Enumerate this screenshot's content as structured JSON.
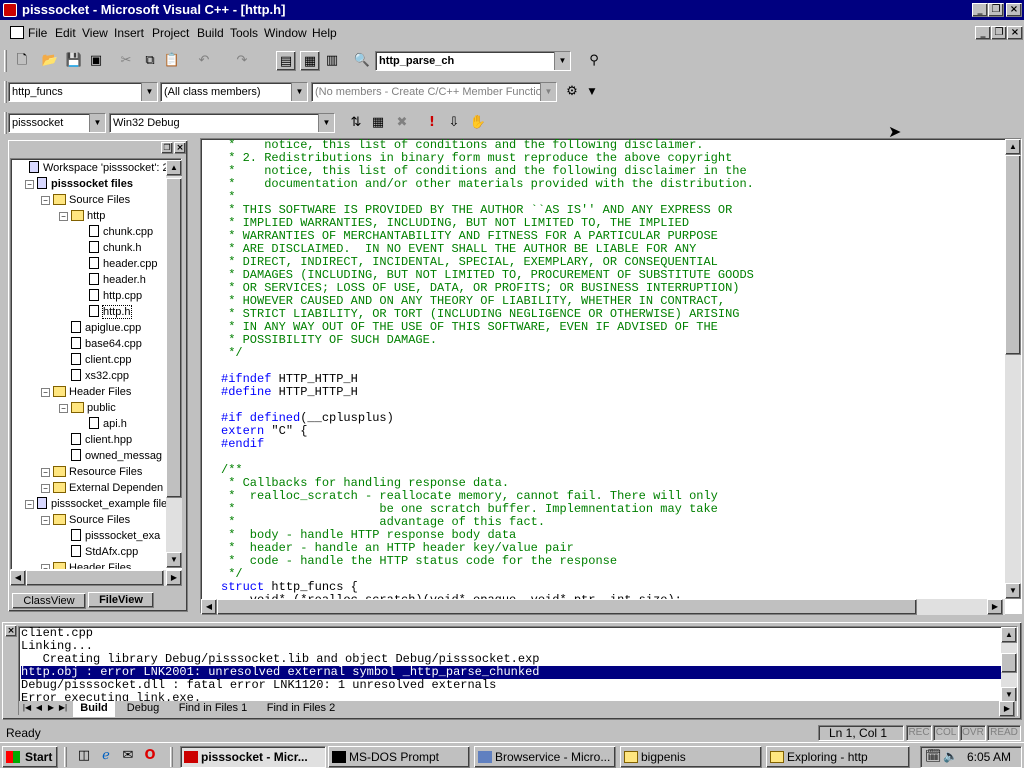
{
  "window": {
    "title": "pisssocket - Microsoft Visual C++ - [http.h]",
    "min": "_",
    "restore": "❐",
    "close": "×"
  },
  "menu": [
    "File",
    "Edit",
    "View",
    "Insert",
    "Project",
    "Build",
    "Tools",
    "Window",
    "Help"
  ],
  "toolbar": {
    "find_combo": "http_parse_ch",
    "class_combo": "http_funcs",
    "filter_combo": "(All class members)",
    "members_combo": "(No members - Create C/C++ Member Function...",
    "project_combo": "pisssocket",
    "config_combo": "Win32 Debug"
  },
  "workspace": {
    "items": [
      {
        "label": "Workspace 'pisssocket': 2 p",
        "type": "ws",
        "level": 0
      },
      {
        "label": "pisssocket files",
        "type": "proj",
        "level": 1,
        "bold": true
      },
      {
        "label": "Source Files",
        "type": "folder",
        "level": 2
      },
      {
        "label": "http",
        "type": "folder",
        "level": 3
      },
      {
        "label": "chunk.cpp",
        "type": "file",
        "level": 4
      },
      {
        "label": "chunk.h",
        "type": "file",
        "level": 4
      },
      {
        "label": "header.cpp",
        "type": "file",
        "level": 4
      },
      {
        "label": "header.h",
        "type": "file",
        "level": 4
      },
      {
        "label": "http.cpp",
        "type": "file",
        "level": 4
      },
      {
        "label": "http.h",
        "type": "file",
        "level": 4
      },
      {
        "label": "apiglue.cpp",
        "type": "file",
        "level": 3
      },
      {
        "label": "base64.cpp",
        "type": "file",
        "level": 3
      },
      {
        "label": "client.cpp",
        "type": "file",
        "level": 3
      },
      {
        "label": "xs32.cpp",
        "type": "file",
        "level": 3
      },
      {
        "label": "Header Files",
        "type": "folder",
        "level": 2
      },
      {
        "label": "public",
        "type": "folder",
        "level": 3
      },
      {
        "label": "api.h",
        "type": "file",
        "level": 4
      },
      {
        "label": "client.hpp",
        "type": "file",
        "level": 3
      },
      {
        "label": "owned_messag",
        "type": "file",
        "level": 3
      },
      {
        "label": "Resource Files",
        "type": "folder",
        "level": 2
      },
      {
        "label": "External Dependen",
        "type": "folder",
        "level": 2
      },
      {
        "label": "pisssocket_example file",
        "type": "proj",
        "level": 1
      },
      {
        "label": "Source Files",
        "type": "folder",
        "level": 2
      },
      {
        "label": "pisssocket_exa",
        "type": "file",
        "level": 3
      },
      {
        "label": "StdAfx.cpp",
        "type": "file",
        "level": 3
      },
      {
        "label": "Header Files",
        "type": "folder",
        "level": 2
      }
    ],
    "tabs": [
      "ClassView",
      "FileView"
    ]
  },
  "code": [
    {
      "t": " *    notice, this list of conditions and the following disclaimer.",
      "c": "cm"
    },
    {
      "t": " * 2. Redistributions in binary form must reproduce the above copyright",
      "c": "cm"
    },
    {
      "t": " *    notice, this list of conditions and the following disclaimer in the",
      "c": "cm"
    },
    {
      "t": " *    documentation and/or other materials provided with the distribution.",
      "c": "cm"
    },
    {
      "t": " *",
      "c": "cm"
    },
    {
      "t": " * THIS SOFTWARE IS PROVIDED BY THE AUTHOR ``AS IS'' AND ANY EXPRESS OR",
      "c": "cm"
    },
    {
      "t": " * IMPLIED WARRANTIES, INCLUDING, BUT NOT LIMITED TO, THE IMPLIED",
      "c": "cm"
    },
    {
      "t": " * WARRANTIES OF MERCHANTABILITY AND FITNESS FOR A PARTICULAR PURPOSE",
      "c": "cm"
    },
    {
      "t": " * ARE DISCLAIMED.  IN NO EVENT SHALL THE AUTHOR BE LIABLE FOR ANY",
      "c": "cm"
    },
    {
      "t": " * DIRECT, INDIRECT, INCIDENTAL, SPECIAL, EXEMPLARY, OR CONSEQUENTIAL",
      "c": "cm"
    },
    {
      "t": " * DAMAGES (INCLUDING, BUT NOT LIMITED TO, PROCUREMENT OF SUBSTITUTE GOODS",
      "c": "cm"
    },
    {
      "t": " * OR SERVICES; LOSS OF USE, DATA, OR PROFITS; OR BUSINESS INTERRUPTION)",
      "c": "cm"
    },
    {
      "t": " * HOWEVER CAUSED AND ON ANY THEORY OF LIABILITY, WHETHER IN CONTRACT,",
      "c": "cm"
    },
    {
      "t": " * STRICT LIABILITY, OR TORT (INCLUDING NEGLIGENCE OR OTHERWISE) ARISING",
      "c": "cm"
    },
    {
      "t": " * IN ANY WAY OUT OF THE USE OF THIS SOFTWARE, EVEN IF ADVISED OF THE",
      "c": "cm"
    },
    {
      "t": " * POSSIBILITY OF SUCH DAMAGE.",
      "c": "cm"
    },
    {
      "t": " */",
      "c": "cm"
    },
    {
      "t": "",
      "c": ""
    },
    {
      "t": "#ifndef HTTP_HTTP_H",
      "c": "pp",
      "kw": "#ifndef"
    },
    {
      "t": "#define HTTP_HTTP_H",
      "c": "pp",
      "kw": "#define"
    },
    {
      "t": "",
      "c": ""
    },
    {
      "t": "#if defined(__cplusplus)",
      "c": "pp",
      "kw": "#if defined"
    },
    {
      "t": "extern \"C\" {",
      "c": "pp",
      "kw": "extern"
    },
    {
      "t": "#endif",
      "c": "pp",
      "kw": "#endif"
    },
    {
      "t": "",
      "c": ""
    },
    {
      "t": "/**",
      "c": "cm"
    },
    {
      "t": " * Callbacks for handling response data.",
      "c": "cm"
    },
    {
      "t": " *  realloc_scratch - reallocate memory, cannot fail. There will only",
      "c": "cm"
    },
    {
      "t": " *                    be one scratch buffer. Implemnentation may take",
      "c": "cm"
    },
    {
      "t": " *                    advantage of this fact.",
      "c": "cm"
    },
    {
      "t": " *  body - handle HTTP response body data",
      "c": "cm"
    },
    {
      "t": " *  header - handle an HTTP header key/value pair",
      "c": "cm"
    },
    {
      "t": " *  code - handle the HTTP status code for the response",
      "c": "cm"
    },
    {
      "t": " */",
      "c": "cm"
    },
    {
      "t": "struct http_funcs {",
      "c": "pp",
      "kw": "struct"
    },
    {
      "t": "    void* (*realloc_scratch)(void* opaque, void* ptr, int size);",
      "c": "pp",
      "kw": ""
    }
  ],
  "output": {
    "lines": [
      {
        "t": "client.cpp",
        "hl": false
      },
      {
        "t": "Linking...",
        "hl": false
      },
      {
        "t": "   Creating library Debug/pisssocket.lib and object Debug/pisssocket.exp",
        "hl": false
      },
      {
        "t": "http.obj : error LNK2001: unresolved external symbol _http_parse_chunked",
        "hl": true
      },
      {
        "t": "Debug/pisssocket.dll : fatal error LNK1120: 1 unresolved externals",
        "hl": false
      },
      {
        "t": "Error executing link.exe.",
        "hl": false
      }
    ],
    "tabs": [
      "Build",
      "Debug",
      "Find in Files 1",
      "Find in Files 2"
    ]
  },
  "status": {
    "text": "Ready",
    "position": "Ln 1, Col 1",
    "rec": "REC",
    "col": "COL",
    "ovr": "OVR",
    "read": "READ"
  },
  "taskbar": {
    "start": "Start",
    "tasks": [
      "pisssocket - Micr...",
      "MS-DOS Prompt",
      "Browservice - Micro...",
      "bigpenis",
      "Exploring - http"
    ],
    "clock": "6:05 AM"
  }
}
